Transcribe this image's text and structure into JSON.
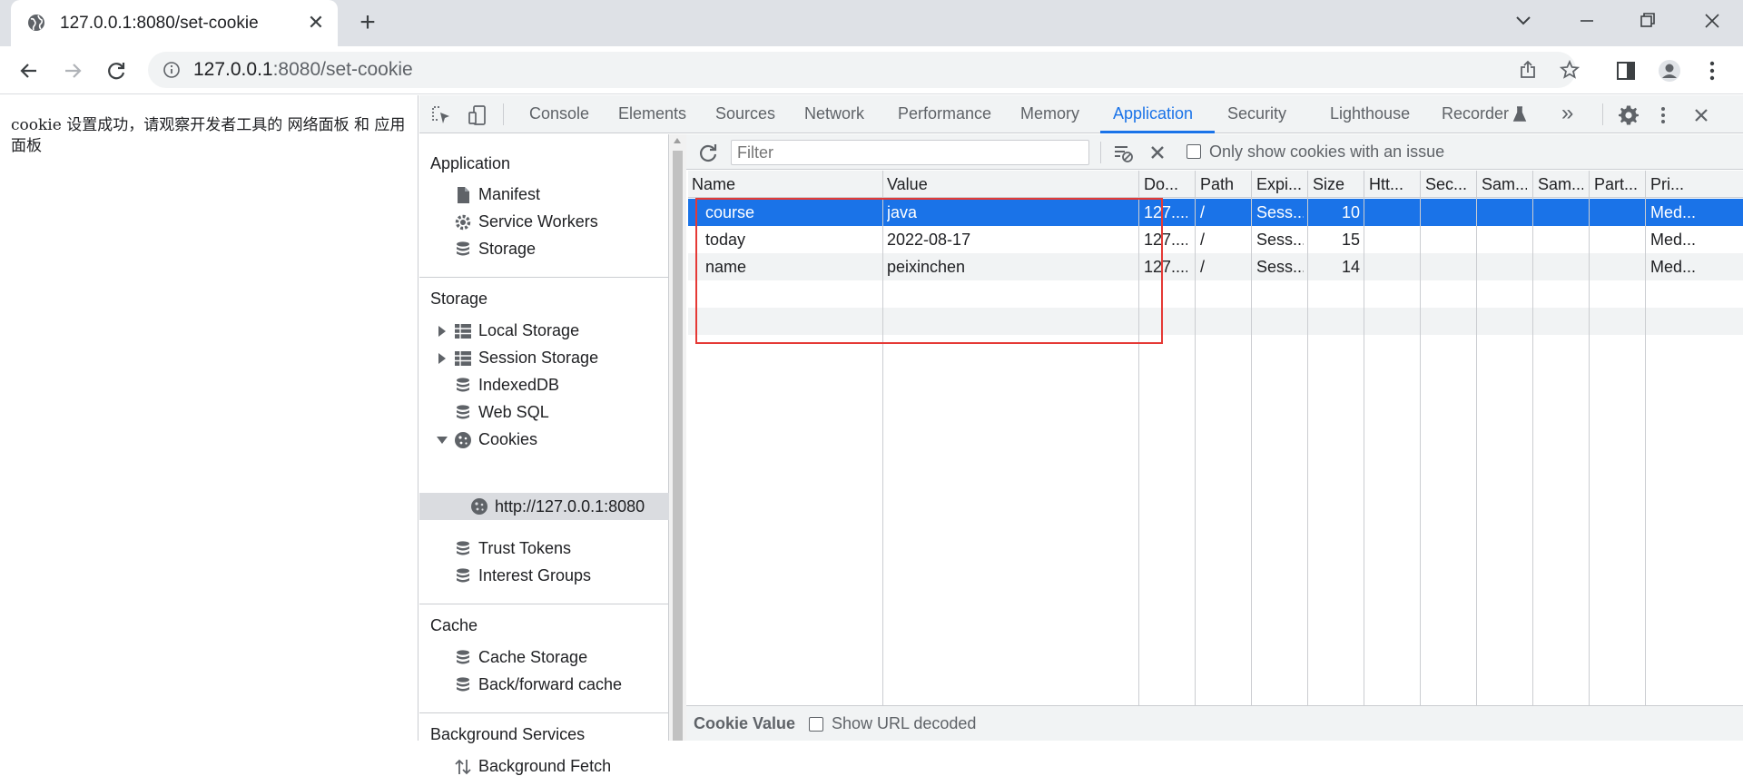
{
  "browser": {
    "tab_title": "127.0.0.1:8080/set-cookie",
    "url_host": "127.0.0.1",
    "url_rest": ":8080/set-cookie"
  },
  "page": {
    "text": "cookie 设置成功，请观察开发者工具的 网络面板 和 应用面板"
  },
  "devtools": {
    "tabs": [
      "Console",
      "Elements",
      "Sources",
      "Network",
      "Performance",
      "Memory",
      "Application",
      "Security",
      "Lighthouse",
      "Recorder"
    ],
    "active_tab": "Application",
    "more_tabs_glyph": "»",
    "sidebar": {
      "application_header": "Application",
      "application_items": [
        "Manifest",
        "Service Workers",
        "Storage"
      ],
      "storage_header": "Storage",
      "storage_items": [
        "Local Storage",
        "Session Storage",
        "IndexedDB",
        "Web SQL",
        "Cookies"
      ],
      "cookie_origin": "http://127.0.0.1:8080",
      "storage_items_after": [
        "Trust Tokens",
        "Interest Groups"
      ],
      "cache_header": "Cache",
      "cache_items": [
        "Cache Storage",
        "Back/forward cache"
      ],
      "background_header": "Background Services",
      "background_items": [
        "Background Fetch"
      ]
    },
    "filter": {
      "placeholder": "Filter",
      "only_issues_label": "Only show cookies with an issue"
    },
    "table": {
      "columns": [
        "Name",
        "Value",
        "Do...",
        "Path",
        "Expi...",
        "Size",
        "Htt...",
        "Sec...",
        "Sam...",
        "Sam...",
        "Part...",
        "Pri..."
      ],
      "rows": [
        {
          "name": "course",
          "value": "java",
          "domain": "127....",
          "path": "/",
          "expires": "Sess...",
          "size": "10",
          "priority": "Med..."
        },
        {
          "name": "today",
          "value": "2022-08-17",
          "domain": "127....",
          "path": "/",
          "expires": "Sess...",
          "size": "15",
          "priority": "Med..."
        },
        {
          "name": "name",
          "value": "peixinchen",
          "domain": "127....",
          "path": "/",
          "expires": "Sess...",
          "size": "14",
          "priority": "Med..."
        }
      ],
      "selected_row": 0
    },
    "cookie_value": {
      "title": "Cookie Value",
      "show_decoded_label": "Show URL decoded"
    }
  },
  "colors": {
    "accent": "#1a73e8",
    "highlight_box": "#e53935"
  }
}
